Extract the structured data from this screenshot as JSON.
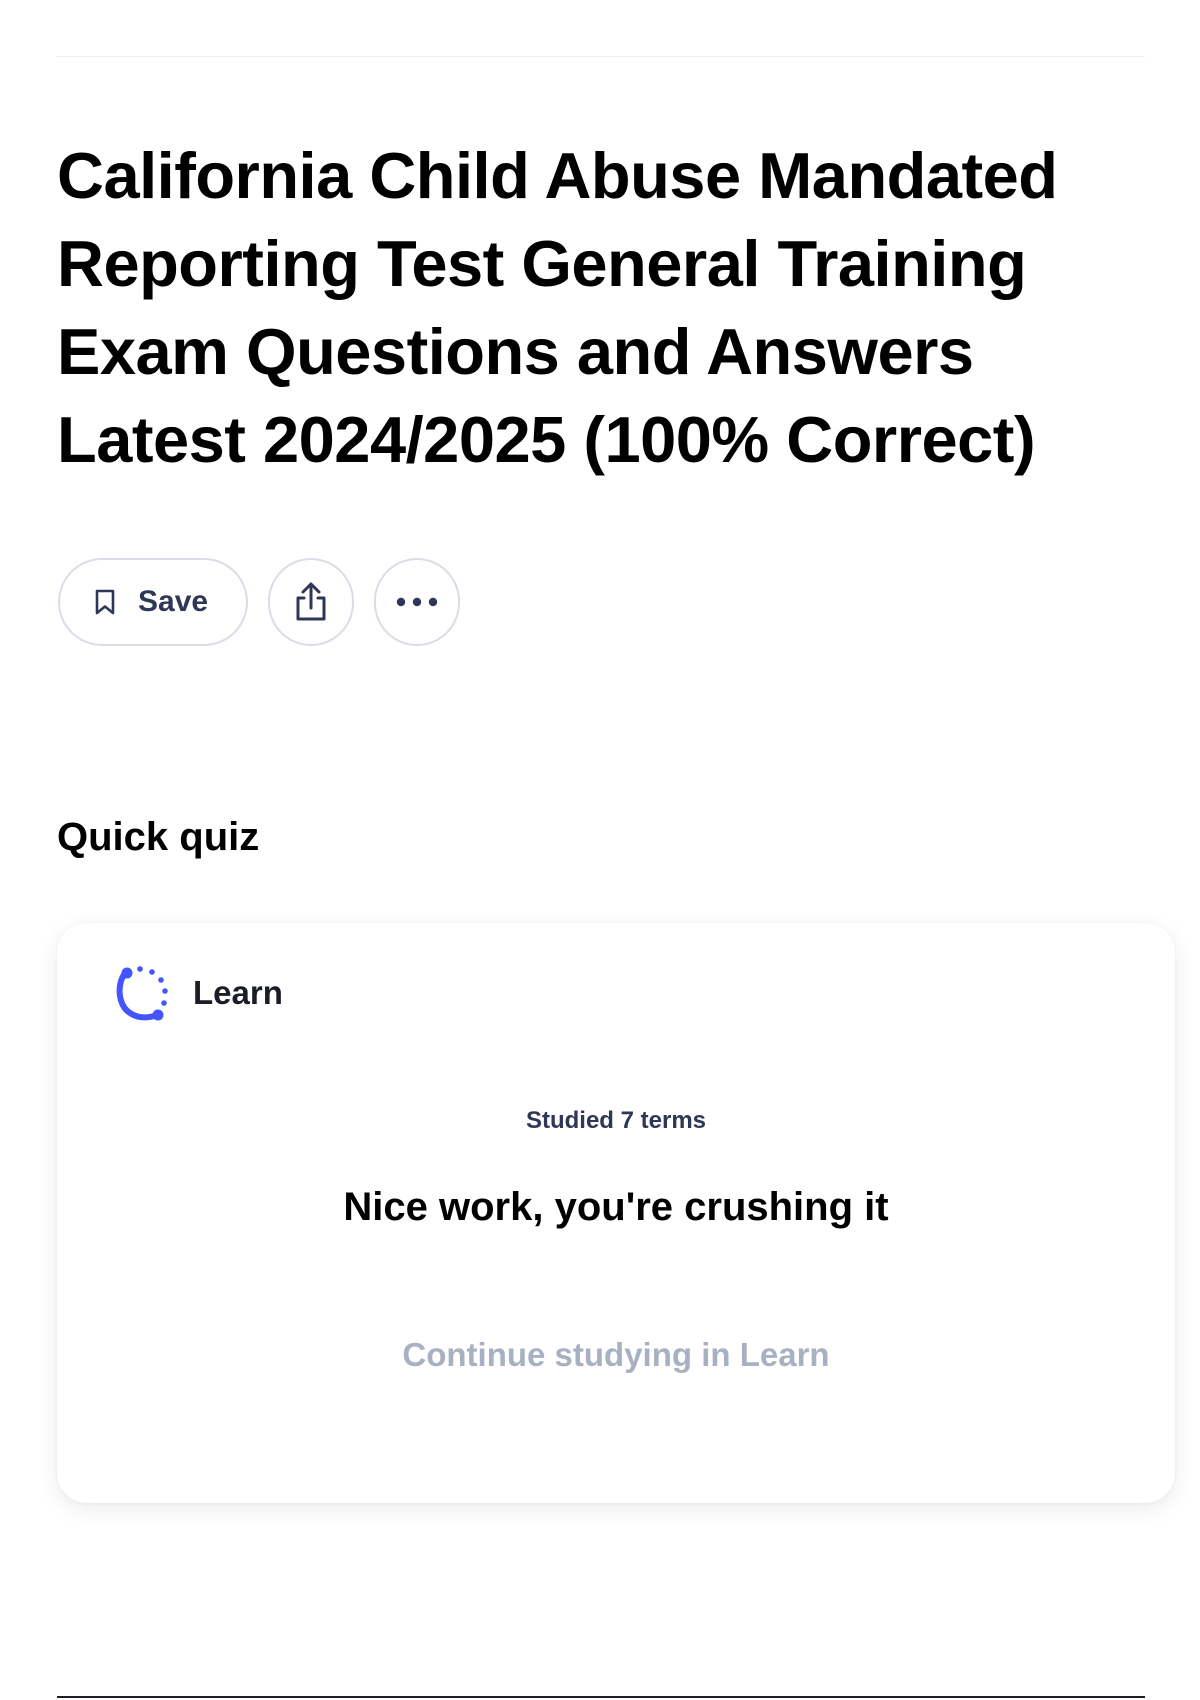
{
  "page": {
    "title": "California Child Abuse Mandated Reporting Test General Training Exam Questions and Answers Latest 2024/2025 (100% Correct)"
  },
  "actions": {
    "save_label": "Save",
    "save_icon": "bookmark-icon",
    "share_icon": "share-icon",
    "more_icon": "more-horizontal-icon"
  },
  "quick_quiz": {
    "heading": "Quick quiz",
    "card": {
      "mode_label": "Learn",
      "mode_icon": "learn-progress-icon",
      "studied_text": "Studied 7 terms",
      "message": "Nice work, you're crushing it",
      "continue_label": "Continue studying in Learn"
    }
  },
  "colors": {
    "accent": "#4255ff",
    "text_primary": "#000000",
    "text_secondary": "#2e3856",
    "text_muted": "#a8b1c2",
    "border": "#d9dde8"
  }
}
